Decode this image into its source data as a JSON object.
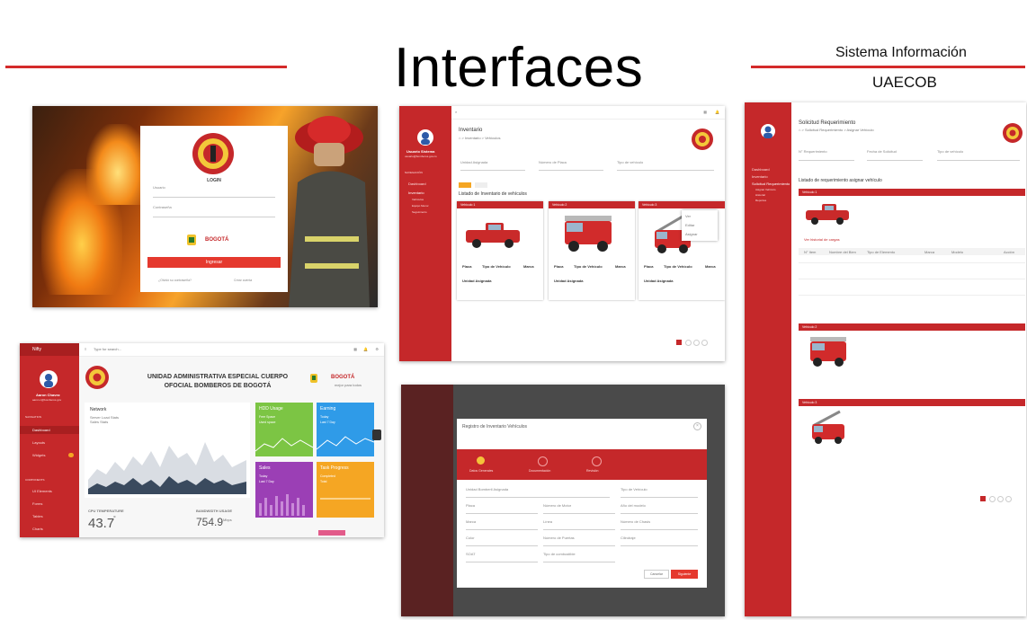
{
  "slide": {
    "title": "Interfaces",
    "system_name": "Sistema Información",
    "system_acronym": "UAECOB"
  },
  "colors": {
    "accent": "#d42a2a",
    "sidebar": "#c5282a",
    "dark_overlay": "#4a4a4a",
    "green": "#7cc544",
    "blue": "#2f9be8",
    "purple": "#9b3fb5",
    "orange": "#f5a623"
  },
  "login": {
    "heading": "LOGIN",
    "user_label": "Usuario",
    "password_label": "Contraseña",
    "submit_label": "Ingresar",
    "forgot_link": "¿Olvidó su contraseña?",
    "create_link": "Crear cuenta",
    "city_logo": "BOGOTÁ"
  },
  "inventory": {
    "page_title": "Inventario",
    "breadcrumb": "⌂ > Inventario > Vehículos",
    "list_title": "Listado de Inventario de vehículos",
    "filter_labels": [
      "Unidad Asignada",
      "Número de Placa",
      "Tipo de vehículo"
    ],
    "user_name": "Usuario Sistema",
    "user_email": "usuario@bomberos.gov.co",
    "nav_section": "NAVEGACIÓN",
    "nav_items": [
      "Dashboard",
      "Inventario",
      "Vehículos",
      "Equipo Menor",
      "Seguimiento"
    ],
    "cards": [
      {
        "head": "Vehículo 1",
        "plate_label": "Placa",
        "type_label": "Tipo de Vehículo",
        "brand_label": "Marca",
        "unit_label": "Unidad Asignada"
      },
      {
        "head": "Vehículo 2",
        "plate_label": "Placa",
        "type_label": "Tipo de Vehículo",
        "brand_label": "Marca",
        "unit_label": "Unidad Asignada"
      },
      {
        "head": "Vehículo 3",
        "plate_label": "Placa",
        "type_label": "Tipo de Vehículo",
        "brand_label": "Marca",
        "unit_label": "Unidad Asignada"
      }
    ],
    "menu_items": [
      "Ver",
      "Editar",
      "Asignar"
    ]
  },
  "requirements": {
    "page_title": "Solicitud Requerimiento",
    "breadcrumb": "⌂ > Solicitud Requerimiento > Asignar Vehículo",
    "list_title": "Listado de requerimiento asignar vehículo",
    "filter_labels": [
      "N° Requerimiento",
      "Fecha de Solicitud",
      "Tipo de vehículo"
    ],
    "section_head": "Vehículo 1",
    "section_head_2": "Vehículo 2",
    "section_head_3": "Vehículo 3",
    "table_headers": [
      "N° Item",
      "Nombre del Bien",
      "Tipo de Elemento",
      "Marca",
      "Modelo",
      "Acción"
    ],
    "assign_text": "Ver historial de cargas",
    "nav_items": [
      "Dashboard",
      "Inventario",
      "Solicitud Requerimiento",
      "Asignar Vehículo",
      "Historial",
      "Reportes"
    ]
  },
  "dashboard": {
    "app_name": "Nifty",
    "search_placeholder": "Type for search...",
    "header_line1": "UNIDAD ADMINISTRATIVA ESPECIAL CUERPO",
    "header_line2": "OFOCIAL BOMBEROS DE BOGOTÁ",
    "city_logo": "BOGOTÁ",
    "city_sub": "mejor para todos",
    "user_name": "Aaron Chavez",
    "user_email": "aaron.c@bomberos.gov",
    "nav_heading": "NAVIGATION",
    "nav_items": [
      "Dashboard",
      "Layouts",
      "Widgets"
    ],
    "components_heading": "COMPONENTS",
    "component_items": [
      "UI Elements",
      "Forms",
      "Tables",
      "Charts"
    ],
    "network_title": "Network",
    "legend_1": "Server Load Stats",
    "legend_2": "Sales Stats",
    "temp_label": "CPU TEMPERATURE",
    "temp_value": "43.7",
    "temp_unit": "°",
    "load_label": "BANDWIDTH USAGE",
    "load_value": "754.9",
    "load_unit": "Mbps",
    "tiles": [
      {
        "title": "HDD Usage",
        "line1": "Free Space",
        "line2": "Used space"
      },
      {
        "title": "Earning",
        "line1": "Today",
        "line2": "Last 7 Day"
      },
      {
        "title": "Sales",
        "line1": "Today",
        "line2": "Last 7 Day"
      },
      {
        "title": "Task Progress",
        "line1": "Completed",
        "line2": "Total"
      }
    ]
  },
  "modal": {
    "title": "Registro de Inventario Vehículos",
    "steps": [
      "Datos Generales",
      "Documentación",
      "Revisión"
    ],
    "fields": [
      "Unidad Bomberil Asignada",
      "Tipo de Vehículo",
      "Placa",
      "Número de Motor",
      "Año del modelo",
      "Marca",
      "Línea",
      "Número de Chasis",
      "Color",
      "Número de Puertas",
      "Cilindraje",
      "SOAT",
      "Tipo de combustible"
    ],
    "cancel_label": "Cancelar",
    "save_label": "Siguiente"
  }
}
